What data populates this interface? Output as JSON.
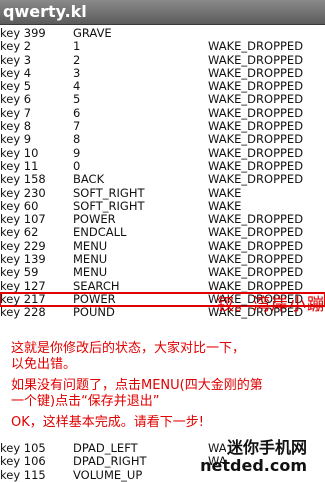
{
  "window": {
    "title": "qwerty.kl"
  },
  "rows": [
    {
      "key": "key 399",
      "code": "GRAVE",
      "flag": ""
    },
    {
      "key": "key 2",
      "code": "1",
      "flag": "WAKE_DROPPED"
    },
    {
      "key": "key 3",
      "code": "2",
      "flag": "WAKE_DROPPED"
    },
    {
      "key": "key 4",
      "code": "3",
      "flag": "WAKE_DROPPED"
    },
    {
      "key": "key 5",
      "code": "4",
      "flag": "WAKE_DROPPED"
    },
    {
      "key": "key 6",
      "code": "5",
      "flag": "WAKE_DROPPED"
    },
    {
      "key": "key 7",
      "code": "6",
      "flag": "WAKE_DROPPED"
    },
    {
      "key": "key 8",
      "code": "7",
      "flag": "WAKE_DROPPED"
    },
    {
      "key": "key 9",
      "code": "8",
      "flag": "WAKE_DROPPED"
    },
    {
      "key": "key 10",
      "code": "9",
      "flag": "WAKE_DROPPED"
    },
    {
      "key": "key 11",
      "code": "0",
      "flag": "WAKE_DROPPED"
    },
    {
      "key": "key 158",
      "code": "BACK",
      "flag": "WAKE_DROPPED"
    },
    {
      "key": "key 230",
      "code": "SOFT_RIGHT",
      "flag": "WAKE"
    },
    {
      "key": "key 60",
      "code": "SOFT_RIGHT",
      "flag": "WAKE"
    },
    {
      "key": "key 107",
      "code": "POWER",
      "flag": "WAKE_DROPPED"
    },
    {
      "key": "key 62",
      "code": "ENDCALL",
      "flag": "WAKE_DROPPED"
    },
    {
      "key": "key 229",
      "code": "MENU",
      "flag": "WAKE_DROPPED"
    },
    {
      "key": "key 139",
      "code": "MENU",
      "flag": "WAKE_DROPPED"
    },
    {
      "key": "key 59",
      "code": "MENU",
      "flag": "WAKE_DROPPED"
    },
    {
      "key": "key 127",
      "code": "SEARCH",
      "flag": "WAKE_DROPPED"
    },
    {
      "key": "key 217",
      "code": "POWER",
      "flag": "WAKE_DROPPED"
    },
    {
      "key": "key 228",
      "code": "POUND",
      "flag": "WAKE_DROPPED"
    }
  ],
  "bottom_rows": [
    {
      "key": "key 105",
      "code": "DPAD_LEFT",
      "flag": "WAKE_DROPPED"
    },
    {
      "key": "key 106",
      "code": "DPAD_RIGHT",
      "flag": "WAKE_DROPPED"
    },
    {
      "key": "key 115",
      "code": "VOLUME_UP",
      "flag": ""
    }
  ],
  "highlight_row_index": 20,
  "annotations": {
    "watermark": "钗。湾岸小蹦",
    "line1": "这就是你修改后的状态，大家对比一下，",
    "line2": "以免出错。",
    "line3": "如果没有问题了，点击MENU(四大金刚的第",
    "line4": "一个键)点击“保存并退出”",
    "line5": "OK，这样基本完成。请看下一步!"
  },
  "logo": {
    "line1": "迷你手机网",
    "line2": "netded.com"
  },
  "colors": {
    "annotation": "#e00000",
    "titlebar": "#6e6e6e"
  }
}
